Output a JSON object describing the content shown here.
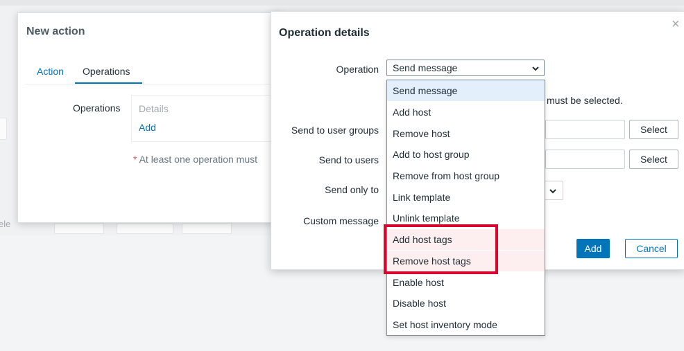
{
  "background": {
    "ghost_text": "ele"
  },
  "new_action_dialog": {
    "title": "New action",
    "tabs": [
      {
        "label": "Action"
      },
      {
        "label": "Operations"
      }
    ],
    "operations_label": "Operations",
    "details_header": "Details",
    "add_link": "Add",
    "warning_star": "*",
    "warning_text": "At least one operation must"
  },
  "operation_details_dialog": {
    "title": "Operation details",
    "close_glyph": "×",
    "operation_label": "Operation",
    "operation_value": "Send message",
    "must_text": "must be selected.",
    "send_to_user_groups_label": "Send to user groups",
    "send_to_users_label": "Send to users",
    "send_only_to_label": "Send only to",
    "custom_message_label": "Custom message",
    "select_button_1": "Select",
    "select_button_2": "Select",
    "add_button": "Add",
    "cancel_button": "Cancel"
  },
  "operation_options": [
    {
      "label": "Send message",
      "state": "selected"
    },
    {
      "label": "Add host",
      "state": ""
    },
    {
      "label": "Remove host",
      "state": ""
    },
    {
      "label": "Add to host group",
      "state": ""
    },
    {
      "label": "Remove from host group",
      "state": ""
    },
    {
      "label": "Link template",
      "state": ""
    },
    {
      "label": "Unlink template",
      "state": ""
    },
    {
      "label": "Add host tags",
      "state": "highlighted"
    },
    {
      "label": "Remove host tags",
      "state": "highlighted"
    },
    {
      "label": "Enable host",
      "state": ""
    },
    {
      "label": "Disable host",
      "state": ""
    },
    {
      "label": "Set host inventory mode",
      "state": ""
    }
  ],
  "colors": {
    "accent": "#0275b8",
    "highlight_outline": "#d9072e",
    "selected_option_bg": "#e3effa",
    "highlighted_option_bg": "#fdeef0"
  }
}
